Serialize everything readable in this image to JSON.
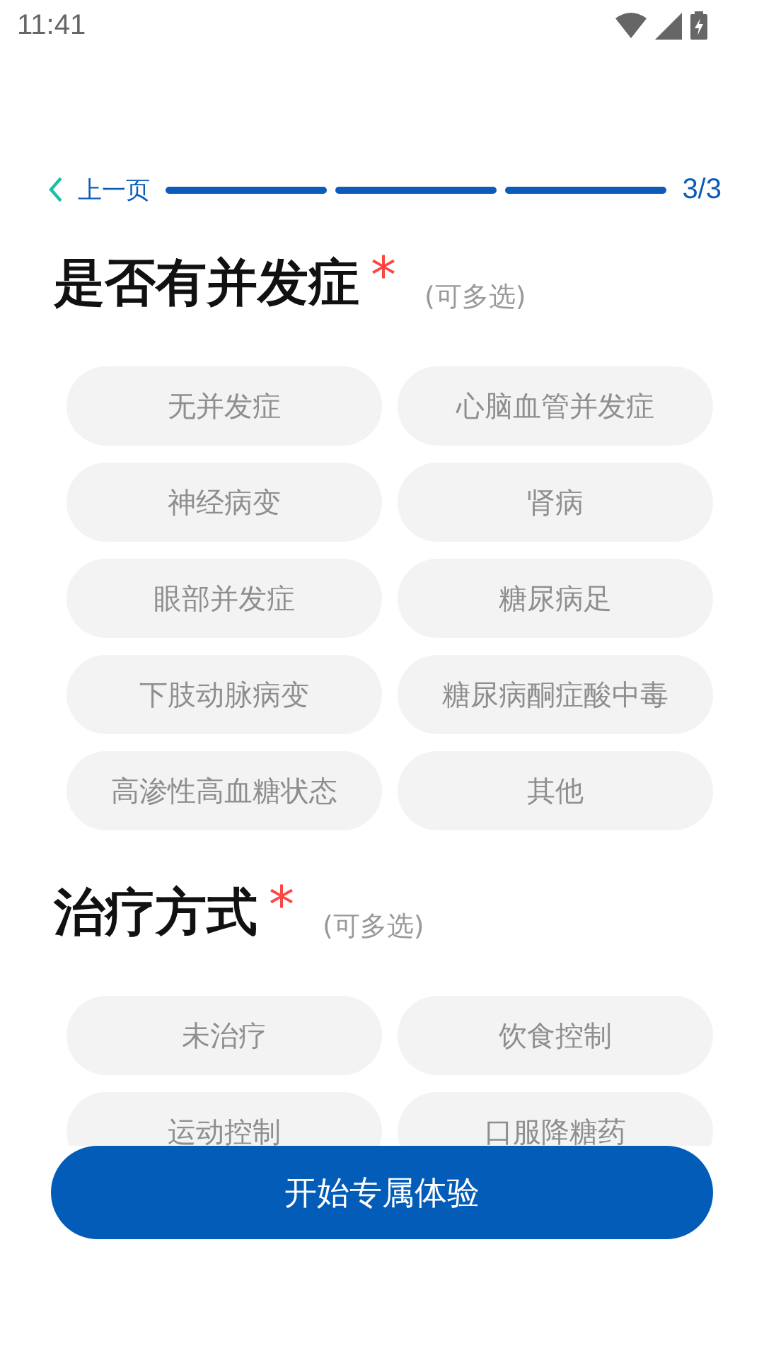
{
  "status_bar": {
    "time": "11:41"
  },
  "header": {
    "back_label": "上一页",
    "progress": [
      {
        "filled": true
      },
      {
        "filled": true
      },
      {
        "filled": true
      }
    ],
    "step": "3/3"
  },
  "sections": [
    {
      "title": "是否有并发症",
      "required_mark": "*",
      "hint": "(可多选)",
      "options": [
        {
          "label": "无并发症",
          "selected": false
        },
        {
          "label": "心脑血管并发症",
          "selected": false
        },
        {
          "label": "神经病变",
          "selected": false
        },
        {
          "label": "肾病",
          "selected": false
        },
        {
          "label": "眼部并发症",
          "selected": false
        },
        {
          "label": "糖尿病足",
          "selected": false
        },
        {
          "label": "下肢动脉病变",
          "selected": false
        },
        {
          "label": "糖尿病酮症酸中毒",
          "selected": false
        },
        {
          "label": "高渗性高血糖状态",
          "selected": false
        },
        {
          "label": "其他",
          "selected": false
        }
      ]
    },
    {
      "title": "治疗方式",
      "required_mark": "*",
      "hint": "(可多选)",
      "options": [
        {
          "label": "未治疗",
          "selected": false
        },
        {
          "label": "饮食控制",
          "selected": false
        },
        {
          "label": "运动控制",
          "selected": false
        },
        {
          "label": "口服降糖药",
          "selected": false
        }
      ]
    }
  ],
  "submit_button": "开始专属体验"
}
